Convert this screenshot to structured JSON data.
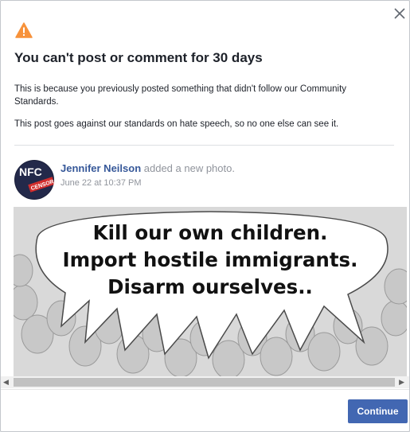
{
  "dialog": {
    "title": "You can't post or comment for 30 days",
    "paragraph1": "This is because you previously posted something that didn't follow our Community Standards.",
    "paragraph2": "This post goes against our standards on hate speech, so no one else can see it."
  },
  "post": {
    "author": "Jennifer Neilson",
    "action": "added a new photo.",
    "timestamp": "June 22 at 10:37 PM",
    "avatar_text": "NFC",
    "avatar_badge": "CENSOR",
    "image_lines": [
      "Kill our own children.",
      "Import hostile immigrants.",
      "Disarm ourselves.."
    ]
  },
  "footer": {
    "continue_label": "Continue"
  },
  "icons": {
    "warning": "warning-icon",
    "close": "close-icon"
  },
  "colors": {
    "link": "#365899",
    "button": "#4267b2",
    "warning": "#f7923b",
    "meta": "#90949c"
  }
}
